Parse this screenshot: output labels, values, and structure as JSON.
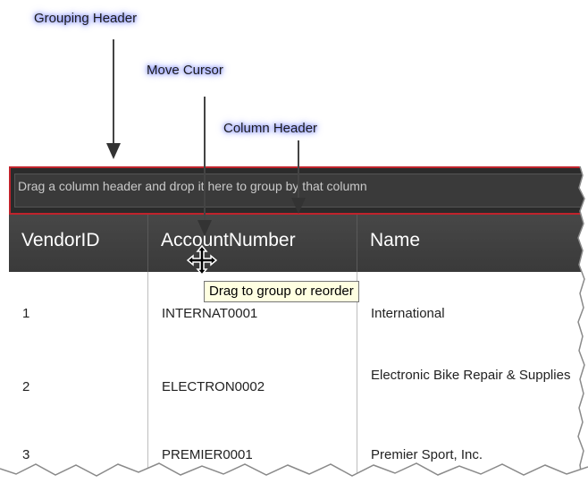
{
  "annotations": {
    "grouping_header": "Grouping Header",
    "move_cursor": "Move Cursor",
    "column_header": "Column Header"
  },
  "grid": {
    "group_hint": "Drag a column header and drop it here to group by that column",
    "columns": [
      "VendorID",
      "AccountNumber",
      "Name"
    ],
    "rows": [
      {
        "vendor_id": "1",
        "account_number": "INTERNAT0001",
        "name": "International"
      },
      {
        "vendor_id": "2",
        "account_number": "ELECTRON0002",
        "name": "Electronic Bike Repair & Supplies"
      },
      {
        "vendor_id": "3",
        "account_number": "PREMIER0001",
        "name": "Premier Sport, Inc."
      }
    ]
  },
  "tooltip": "Drag to group or reorder",
  "colors": {
    "group_border": "#c0232c",
    "header_bg": "#3f3f3f",
    "tooltip_bg": "#ffffe1",
    "callout_glow": "#6f7dff"
  },
  "icons": [
    "move-cursor-icon",
    "down-arrow-icon"
  ]
}
